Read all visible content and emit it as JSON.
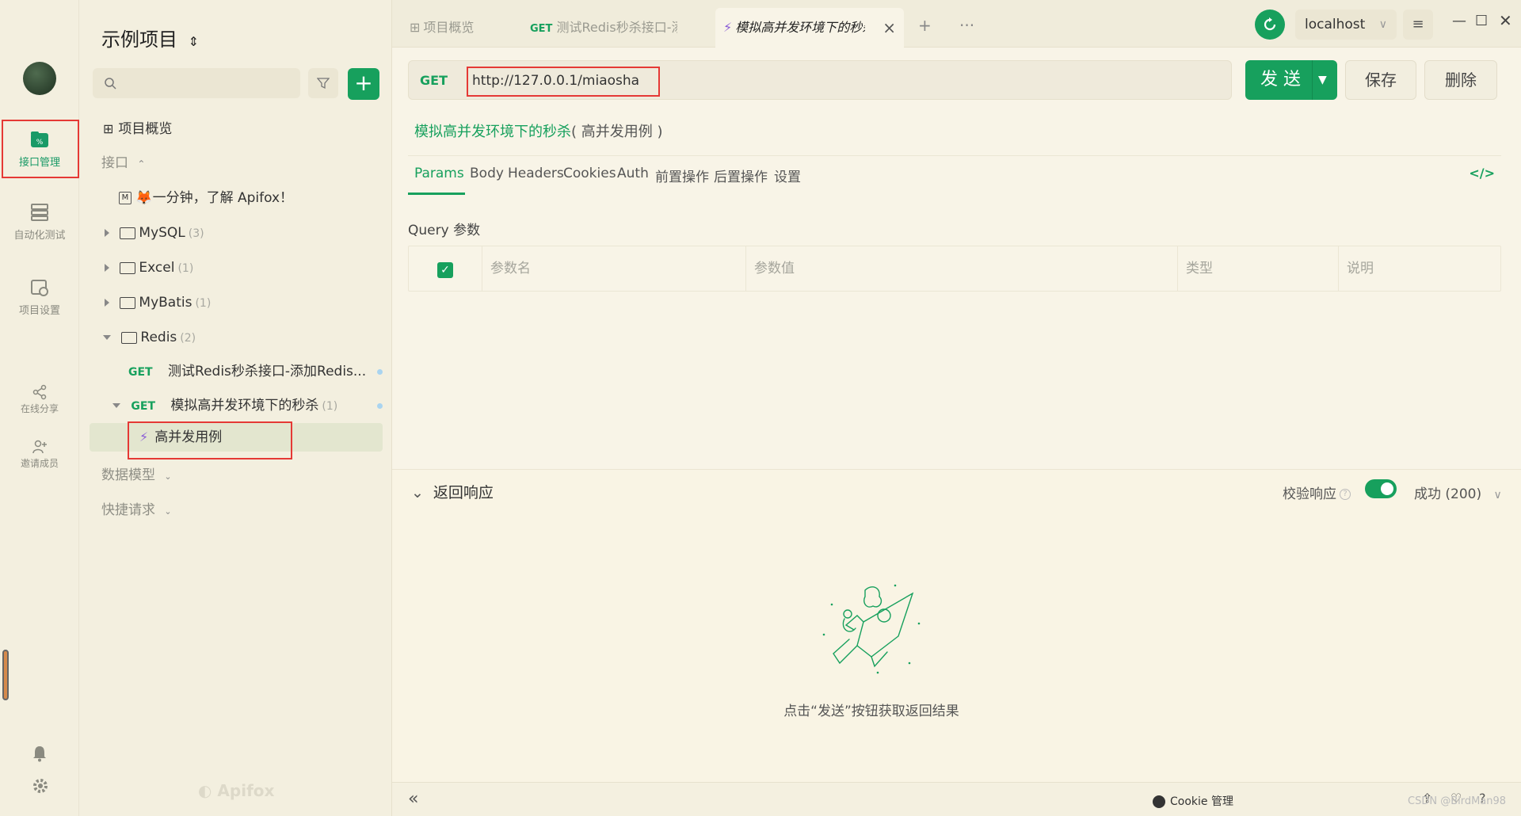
{
  "rail": {
    "items": [
      {
        "label": "接口管理"
      },
      {
        "label": "自动化测试"
      },
      {
        "label": "项目设置"
      },
      {
        "label": "在线分享"
      },
      {
        "label": "邀请成员"
      }
    ]
  },
  "sidebar": {
    "project_title": "示例项目",
    "overview_label": "项目概览",
    "section_api": "接口",
    "intro_doc": "一分钟，了解 Apifox！",
    "folders": [
      {
        "name": "MySQL",
        "count": "(3)"
      },
      {
        "name": "Excel",
        "count": "(1)"
      },
      {
        "name": "MyBatis",
        "count": "(1)"
      },
      {
        "name": "Redis",
        "count": "(2)"
      }
    ],
    "redis_children": [
      {
        "method": "GET",
        "name": "测试Redis秒杀接口-添加Redis..."
      },
      {
        "method": "GET",
        "name": "模拟高并发环境下的秒杀",
        "count": "(1)"
      }
    ],
    "case_item": "高并发用例",
    "section_models": "数据模型",
    "section_quick": "快捷请求",
    "watermark": "Apifox"
  },
  "tabs": [
    {
      "label": "项目概览"
    },
    {
      "method": "GET",
      "label": "测试Redis秒杀接口-添"
    },
    {
      "label": "模拟高并发环境下的秒杀"
    }
  ],
  "header": {
    "env": "localhost"
  },
  "request": {
    "method": "GET",
    "url": "http://127.0.0.1/miaosha",
    "send_label": "发 送",
    "save_label": "保存",
    "delete_label": "删除",
    "title": "模拟高并发环境下的秒杀",
    "title_sub": "( 高并发用例 )"
  },
  "subtabs": [
    "Params",
    "Body",
    "Headers",
    "Cookies",
    "Auth",
    "前置操作",
    "后置操作",
    "设置"
  ],
  "params": {
    "query_label": "Query 参数",
    "columns": [
      "参数名",
      "参数值",
      "类型",
      "说明"
    ]
  },
  "response": {
    "title": "返回响应",
    "validate_label": "校验响应",
    "status": "成功 (200)",
    "empty_hint": "点击“发送”按钮获取返回结果"
  },
  "footer": {
    "cookie_label": "Cookie 管理",
    "watermark": "CSDN @BirdMan98"
  },
  "colors": {
    "accent": "#17a05d",
    "highlight_box": "#e53935"
  }
}
